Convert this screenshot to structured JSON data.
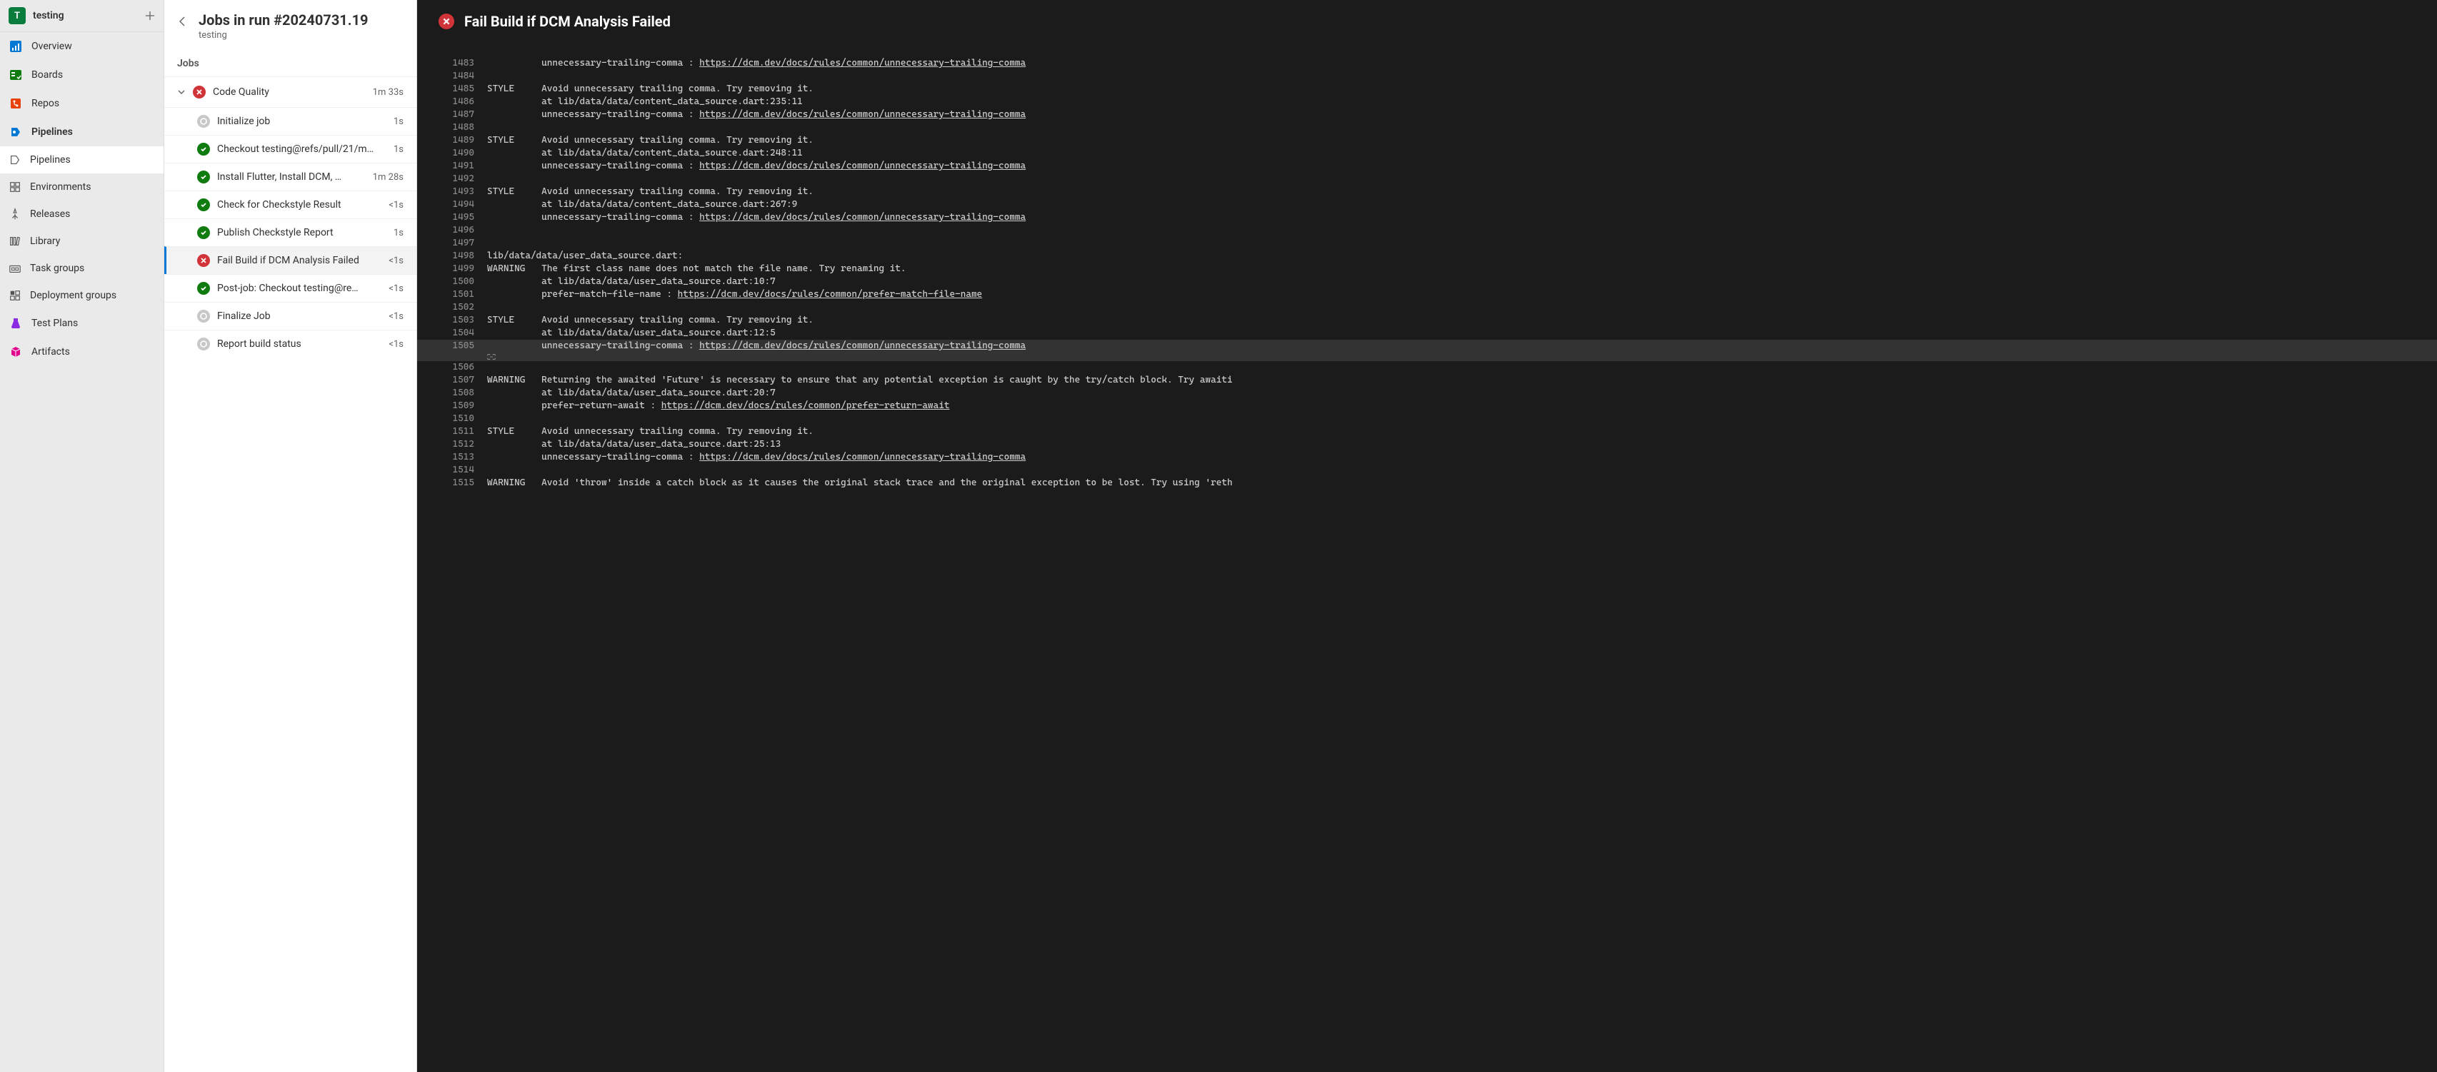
{
  "project": {
    "initial": "T",
    "name": "testing"
  },
  "sidebar": {
    "items": [
      {
        "key": "overview",
        "label": "Overview"
      },
      {
        "key": "boards",
        "label": "Boards"
      },
      {
        "key": "repos",
        "label": "Repos"
      },
      {
        "key": "pipelines",
        "label": "Pipelines",
        "bold": true
      },
      {
        "key": "pipelines-sub",
        "label": "Pipelines",
        "sub": true,
        "selected": true
      },
      {
        "key": "environments",
        "label": "Environments",
        "sub": true
      },
      {
        "key": "releases",
        "label": "Releases",
        "sub": true
      },
      {
        "key": "library",
        "label": "Library",
        "sub": true
      },
      {
        "key": "task-groups",
        "label": "Task groups",
        "sub": true
      },
      {
        "key": "deployment-groups",
        "label": "Deployment groups",
        "sub": true
      },
      {
        "key": "test-plans",
        "label": "Test Plans"
      },
      {
        "key": "artifacts",
        "label": "Artifacts"
      }
    ]
  },
  "run": {
    "title": "Jobs in run #20240731.19",
    "subtitle": "testing",
    "section": "Jobs",
    "group": {
      "name": "Code Quality",
      "status": "fail",
      "time": "1m 33s"
    },
    "steps": [
      {
        "status": "skip",
        "name": "Initialize job",
        "time": "1s"
      },
      {
        "status": "success",
        "name": "Checkout testing@refs/pull/21/m…",
        "time": "1s"
      },
      {
        "status": "success",
        "name": "Install Flutter, Install DCM, …",
        "time": "1m 28s"
      },
      {
        "status": "success",
        "name": "Check for Checkstyle Result",
        "time": "<1s"
      },
      {
        "status": "success",
        "name": "Publish Checkstyle Report",
        "time": "1s"
      },
      {
        "status": "fail",
        "name": "Fail Build if DCM Analysis Failed",
        "time": "<1s",
        "selected": true
      },
      {
        "status": "success",
        "name": "Post-job: Checkout testing@re…",
        "time": "<1s"
      },
      {
        "status": "skip",
        "name": "Finalize Job",
        "time": "<1s"
      },
      {
        "status": "skip",
        "name": "Report build status",
        "time": "<1s"
      }
    ]
  },
  "log": {
    "title": "Fail Build if DCM Analysis Failed",
    "status": "fail",
    "lines": [
      {
        "n": 1483,
        "tag": "",
        "text": "          unnecessary-trailing-comma : ",
        "link": "https://dcm.dev/docs/rules/common/unnecessary-trailing-comma"
      },
      {
        "n": 1484,
        "tag": "",
        "text": ""
      },
      {
        "n": 1485,
        "tag": "STYLE",
        "text": "Avoid unnecessary trailing comma. Try removing it."
      },
      {
        "n": 1486,
        "tag": "",
        "text": "          at lib/data/data/content_data_source.dart:235:11"
      },
      {
        "n": 1487,
        "tag": "",
        "text": "          unnecessary-trailing-comma : ",
        "link": "https://dcm.dev/docs/rules/common/unnecessary-trailing-comma"
      },
      {
        "n": 1488,
        "tag": "",
        "text": ""
      },
      {
        "n": 1489,
        "tag": "STYLE",
        "text": "Avoid unnecessary trailing comma. Try removing it."
      },
      {
        "n": 1490,
        "tag": "",
        "text": "          at lib/data/data/content_data_source.dart:248:11"
      },
      {
        "n": 1491,
        "tag": "",
        "text": "          unnecessary-trailing-comma : ",
        "link": "https://dcm.dev/docs/rules/common/unnecessary-trailing-comma"
      },
      {
        "n": 1492,
        "tag": "",
        "text": ""
      },
      {
        "n": 1493,
        "tag": "STYLE",
        "text": "Avoid unnecessary trailing comma. Try removing it."
      },
      {
        "n": 1494,
        "tag": "",
        "text": "          at lib/data/data/content_data_source.dart:267:9"
      },
      {
        "n": 1495,
        "tag": "",
        "text": "          unnecessary-trailing-comma : ",
        "link": "https://dcm.dev/docs/rules/common/unnecessary-trailing-comma"
      },
      {
        "n": 1496,
        "tag": "",
        "text": ""
      },
      {
        "n": 1497,
        "tag": "",
        "text": ""
      },
      {
        "n": 1498,
        "tag": "",
        "text": "lib/data/data/user_data_source.dart:"
      },
      {
        "n": 1499,
        "tag": "WARNING",
        "text": "The first class name does not match the file name. Try renaming it."
      },
      {
        "n": 1500,
        "tag": "",
        "text": "          at lib/data/data/user_data_source.dart:10:7"
      },
      {
        "n": 1501,
        "tag": "",
        "text": "          prefer-match-file-name : ",
        "link": "https://dcm.dev/docs/rules/common/prefer-match-file-name"
      },
      {
        "n": 1502,
        "tag": "",
        "text": ""
      },
      {
        "n": 1503,
        "tag": "STYLE",
        "text": "Avoid unnecessary trailing comma. Try removing it."
      },
      {
        "n": 1504,
        "tag": "",
        "text": "          at lib/data/data/user_data_source.dart:12:5"
      },
      {
        "n": 1505,
        "tag": "",
        "text": "          unnecessary-trailing-comma : ",
        "link": "https://dcm.dev/docs/rules/common/unnecessary-trailing-comma",
        "highlighted": true,
        "linkIcon": true
      },
      {
        "n": 1506,
        "tag": "",
        "text": ""
      },
      {
        "n": 1507,
        "tag": "WARNING",
        "text": "Returning the awaited 'Future' is necessary to ensure that any potential exception is caught by the try/catch block. Try awaiti"
      },
      {
        "n": 1508,
        "tag": "",
        "text": "          at lib/data/data/user_data_source.dart:20:7"
      },
      {
        "n": 1509,
        "tag": "",
        "text": "          prefer-return-await : ",
        "link": "https://dcm.dev/docs/rules/common/prefer-return-await"
      },
      {
        "n": 1510,
        "tag": "",
        "text": ""
      },
      {
        "n": 1511,
        "tag": "STYLE",
        "text": "Avoid unnecessary trailing comma. Try removing it."
      },
      {
        "n": 1512,
        "tag": "",
        "text": "          at lib/data/data/user_data_source.dart:25:13"
      },
      {
        "n": 1513,
        "tag": "",
        "text": "          unnecessary-trailing-comma : ",
        "link": "https://dcm.dev/docs/rules/common/unnecessary-trailing-comma"
      },
      {
        "n": 1514,
        "tag": "",
        "text": ""
      },
      {
        "n": 1515,
        "tag": "WARNING",
        "text": "Avoid 'throw' inside a catch block as it causes the original stack trace and the original exception to be lost. Try using 'reth"
      }
    ]
  }
}
